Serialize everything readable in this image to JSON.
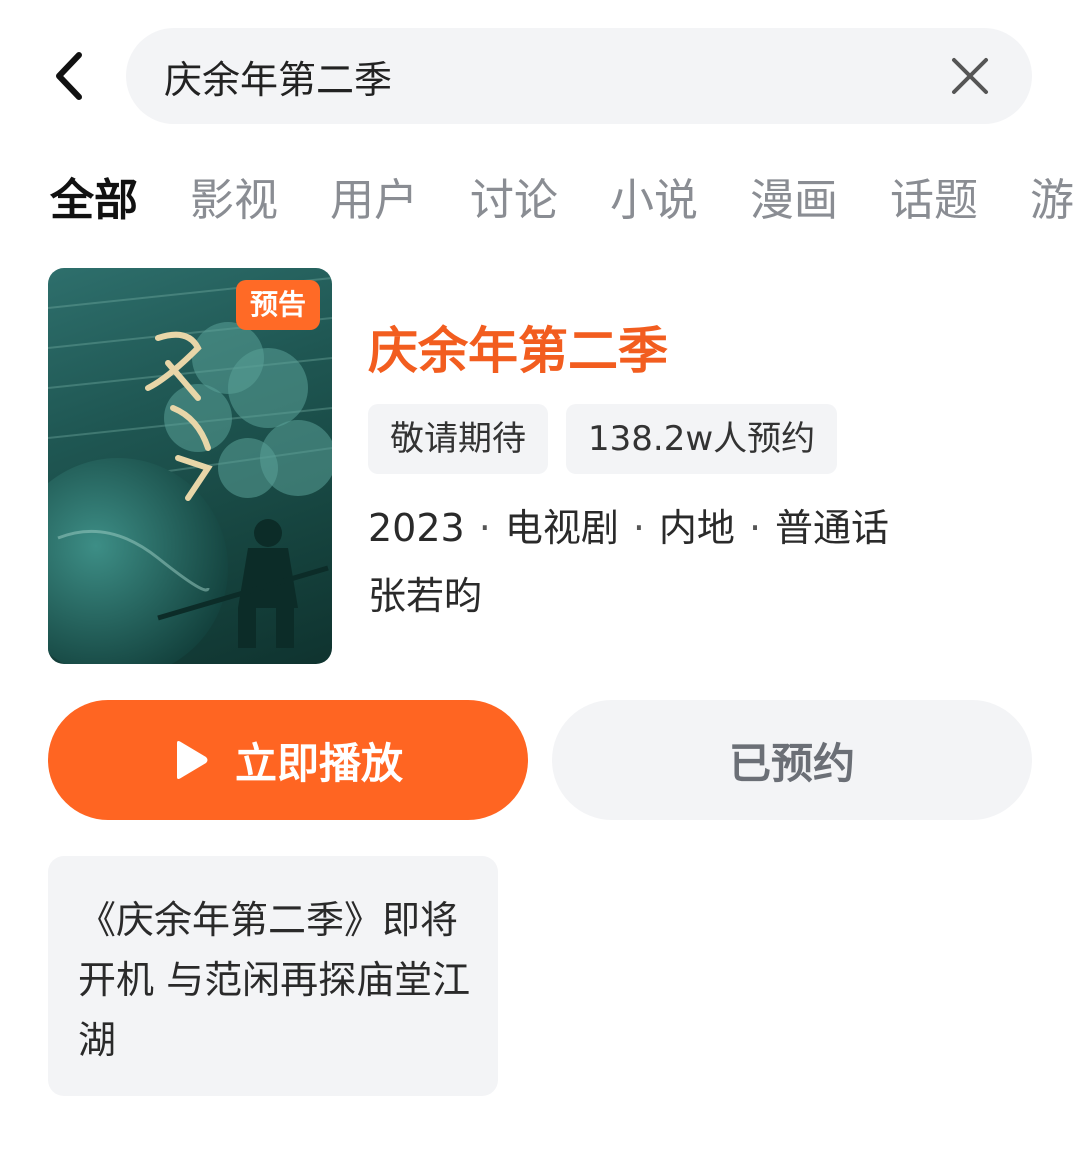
{
  "search": {
    "query": "庆余年第二季"
  },
  "tabs": [
    {
      "label": "全部",
      "active": true
    },
    {
      "label": "影视",
      "active": false
    },
    {
      "label": "用户",
      "active": false
    },
    {
      "label": "讨论",
      "active": false
    },
    {
      "label": "小说",
      "active": false
    },
    {
      "label": "漫画",
      "active": false
    },
    {
      "label": "话题",
      "active": false
    },
    {
      "label": "游",
      "active": false
    }
  ],
  "media": {
    "poster_badge": "预告",
    "poster_icon": "drama-poster-image",
    "title": "庆余年第二季",
    "tags": [
      "敬请期待",
      "138.2w人预约"
    ],
    "meta": [
      "2023",
      "电视剧",
      "内地",
      "普通话"
    ],
    "meta_separator": "·",
    "actor": "张若昀"
  },
  "buttons": {
    "play_label": "立即播放",
    "reserved_label": "已预约"
  },
  "news": {
    "text": "《庆余年第二季》即将开机 与范闲再探庙堂江湖"
  },
  "colors": {
    "accent": "#ff6522",
    "title": "#f25d1f",
    "chip_bg": "#f3f4f6",
    "inactive_tab": "#8a8d93"
  }
}
